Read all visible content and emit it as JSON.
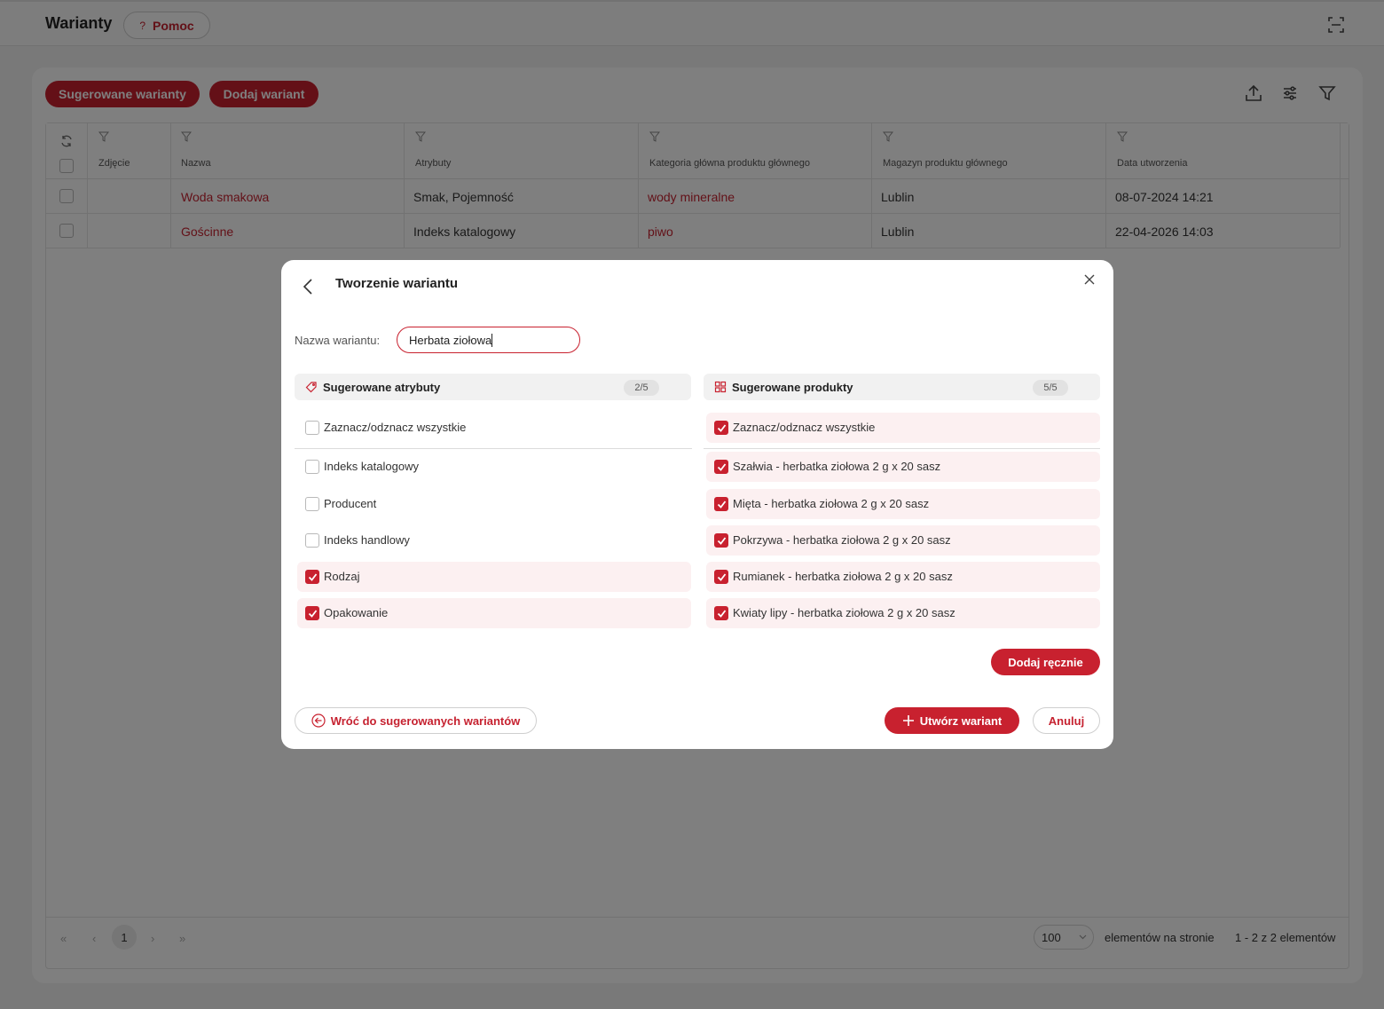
{
  "header": {
    "title": "Warianty",
    "help_label": "Pomoc",
    "help_glyph": "?"
  },
  "toolbar": {
    "suggested_label": "Sugerowane warianty",
    "add_label": "Dodaj wariant",
    "icons": [
      "export-icon",
      "settings-sliders-icon",
      "filter-icon"
    ]
  },
  "table": {
    "columns": [
      "Zdjęcie",
      "Nazwa",
      "Atrybuty",
      "Kategoria główna produktu głównego",
      "Magazyn produktu głównego",
      "Data utworzenia"
    ],
    "rows": [
      {
        "name": "Woda smakowa",
        "attributes": "Smak, Pojemność",
        "category": "wody mineralne",
        "warehouse": "Lublin",
        "created": "08-07-2024 14:21"
      },
      {
        "name": "Gościnne",
        "attributes": "Indeks katalogowy",
        "category": "piwo",
        "warehouse": "Lublin",
        "created": "22-04-2026 14:03"
      }
    ]
  },
  "pagination": {
    "first": "«",
    "prev": "‹",
    "current_page": "1",
    "next": "›",
    "last": "»",
    "per_page": "100",
    "per_page_label": "elementów na stronie",
    "range_label": "1 - 2 z 2 elementów"
  },
  "modal": {
    "title": "Tworzenie wariantu",
    "name_label": "Nazwa wariantu:",
    "name_value": "Herbata ziołowa",
    "attributes": {
      "title": "Sugerowane atrybuty",
      "count": "2/5",
      "select_all": "Zaznacz/odznacz wszystkie",
      "select_all_checked": false,
      "items": [
        {
          "label": "Indeks katalogowy",
          "checked": false
        },
        {
          "label": "Producent",
          "checked": false
        },
        {
          "label": "Indeks handlowy",
          "checked": false
        },
        {
          "label": "Rodzaj",
          "checked": true
        },
        {
          "label": "Opakowanie",
          "checked": true
        }
      ]
    },
    "products": {
      "title": "Sugerowane produkty",
      "count": "5/5",
      "select_all": "Zaznacz/odznacz wszystkie",
      "select_all_checked": true,
      "items": [
        {
          "label": "Szałwia - herbatka ziołowa 2 g x 20 sasz",
          "checked": true
        },
        {
          "label": "Mięta - herbatka ziołowa 2 g x 20 sasz",
          "checked": true
        },
        {
          "label": "Pokrzywa - herbatka ziołowa 2 g x 20 sasz",
          "checked": true
        },
        {
          "label": "Rumianek - herbatka ziołowa 2 g x 20 sasz",
          "checked": true
        },
        {
          "label": "Kwiaty lipy - herbatka ziołowa 2 g x 20 sasz",
          "checked": true
        }
      ]
    },
    "add_manual_label": "Dodaj ręcznie",
    "back_label": "Wróć do sugerowanych wariantów",
    "create_label": "Utwórz wariant",
    "cancel_label": "Anuluj"
  },
  "colors": {
    "accent": "#c8212f",
    "selected_row_bg": "#fcf0f1",
    "overlay": "rgba(0,0,0,0.5)"
  }
}
